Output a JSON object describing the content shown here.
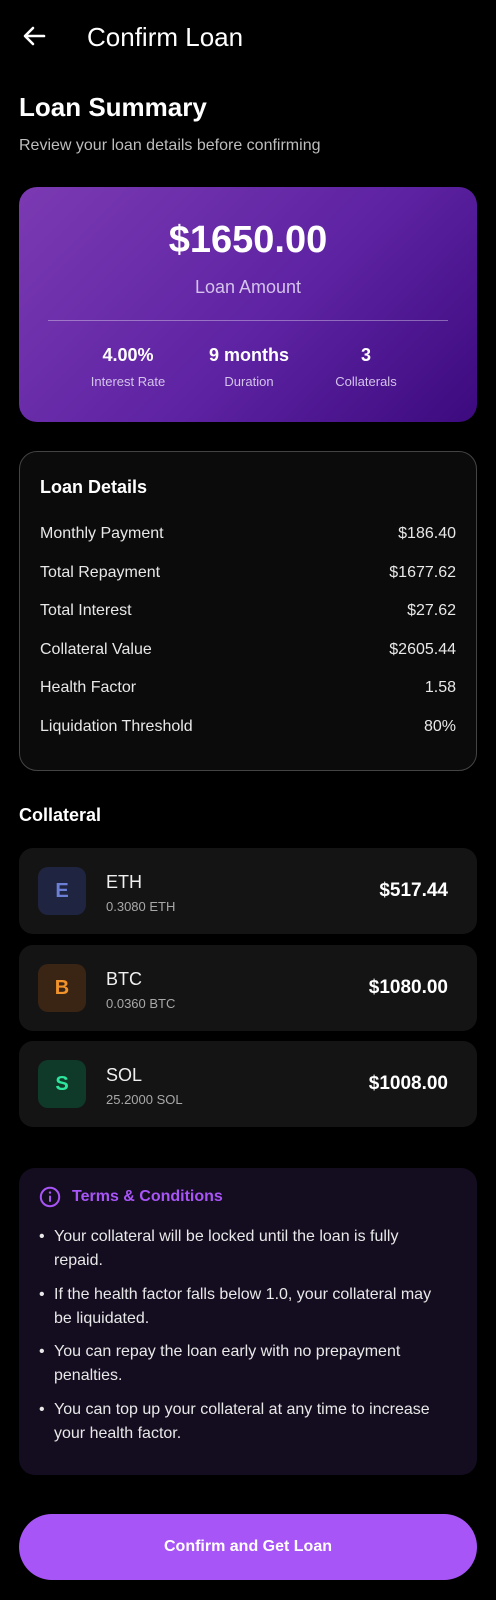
{
  "appbar": {
    "title": "Confirm Loan",
    "back_icon": "arrow-left-icon"
  },
  "summary": {
    "title": "Loan Summary",
    "subtitle": "Review your loan details before confirming"
  },
  "hero": {
    "amount": "$1650.00",
    "amount_label": "Loan Amount",
    "stats": [
      {
        "value": "4.00%",
        "label": "Interest Rate"
      },
      {
        "value": "9 months",
        "label": "Duration"
      },
      {
        "value": "3",
        "label": "Collaterals"
      }
    ],
    "gradient": [
      "#7b3ab2",
      "#3c0a7e"
    ]
  },
  "details": {
    "title": "Loan Details",
    "rows": [
      {
        "label": "Monthly Payment",
        "value": "$186.40"
      },
      {
        "label": "Total Repayment",
        "value": "$1677.62"
      },
      {
        "label": "Total Interest",
        "value": "$27.62"
      },
      {
        "label": "Collateral Value",
        "value": "$2605.44"
      },
      {
        "label": "Health Factor",
        "value": "1.58"
      },
      {
        "label": "Liquidation Threshold",
        "value": "80%"
      }
    ]
  },
  "collateral": {
    "title": "Collateral",
    "items": [
      {
        "letter": "E",
        "symbol": "ETH",
        "amount": "0.3080 ETH",
        "value": "$517.44",
        "color": "#6b7fd7",
        "bg": "#1f2540"
      },
      {
        "letter": "B",
        "symbol": "BTC",
        "amount": "0.0360 BTC",
        "value": "$1080.00",
        "color": "#f0932b",
        "bg": "#3a2414"
      },
      {
        "letter": "S",
        "symbol": "SOL",
        "amount": "25.2000 SOL",
        "value": "$1008.00",
        "color": "#2ee59d",
        "bg": "#0f3a2a"
      }
    ]
  },
  "terms": {
    "title": "Terms & Conditions",
    "icon": "info-icon",
    "bullet_char": "•",
    "items": [
      "Your collateral will be locked until the loan is fully repaid.",
      "If the health factor falls below 1.0, your collateral may be liquidated.",
      "You can repay the loan early with no prepayment penalties.",
      "You can top up your collateral at any time to increase your health factor."
    ]
  },
  "cta": {
    "label": "Confirm and Get Loan",
    "color": "#a855f7"
  }
}
